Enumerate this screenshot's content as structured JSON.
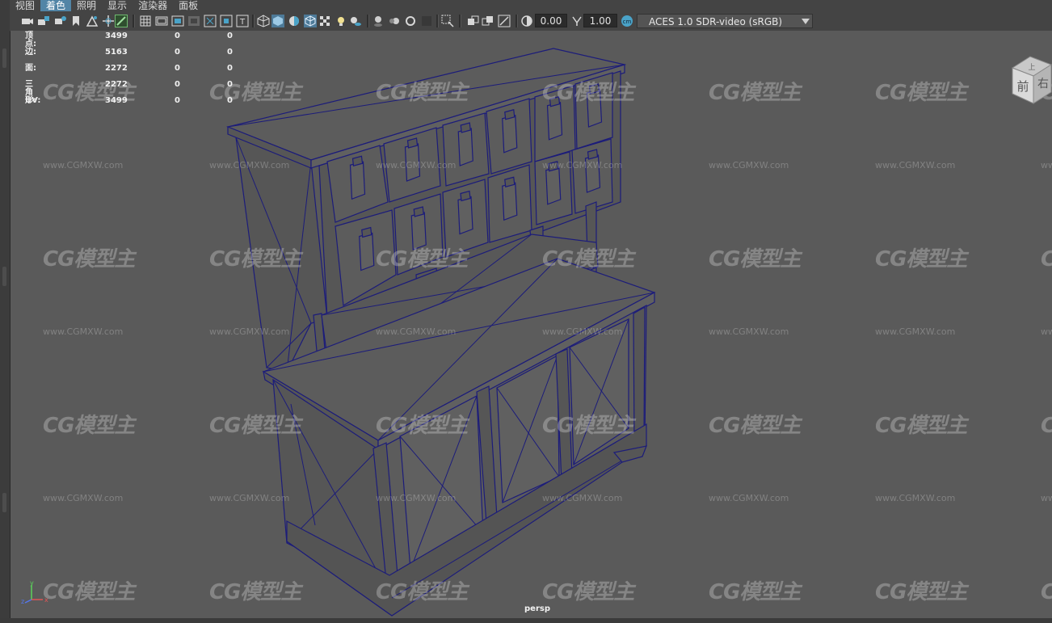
{
  "menu": {
    "items": [
      {
        "label": "视图",
        "active": false
      },
      {
        "label": "着色",
        "active": true
      },
      {
        "label": "照明",
        "active": false
      },
      {
        "label": "显示",
        "active": false
      },
      {
        "label": "渲染器",
        "active": false
      },
      {
        "label": "面板",
        "active": false
      }
    ]
  },
  "toolbar": {
    "exposure_value": "0.00",
    "gamma_value": "1.00",
    "color_management": "ACES 1.0 SDR-video (sRGB)"
  },
  "hud": {
    "rows": [
      {
        "label": "顶点:",
        "v1": "3499",
        "v2": "0",
        "v3": "0"
      },
      {
        "label": "边:",
        "v1": "5163",
        "v2": "0",
        "v3": "0"
      },
      {
        "label": "面:",
        "v1": "2272",
        "v2": "0",
        "v3": "0"
      },
      {
        "label": "三角形:",
        "v1": "2272",
        "v2": "0",
        "v3": "0"
      },
      {
        "label": "UV:",
        "v1": "3499",
        "v2": "0",
        "v3": "0"
      }
    ]
  },
  "viewport": {
    "camera_label": "persp",
    "viewcube_front": "前",
    "viewcube_right": "右",
    "viewcube_top": "上",
    "axis_x": "x",
    "axis_y": "y",
    "axis_z": "z",
    "wireframe_color": "#1c1c7a",
    "background_color": "#5a5a5a"
  },
  "watermark": {
    "brand": "CG模型主",
    "url": "www.CGMXW.com"
  },
  "colors": {
    "accent": "#5285a6",
    "panel": "#444444",
    "field": "#2b2b2b"
  }
}
